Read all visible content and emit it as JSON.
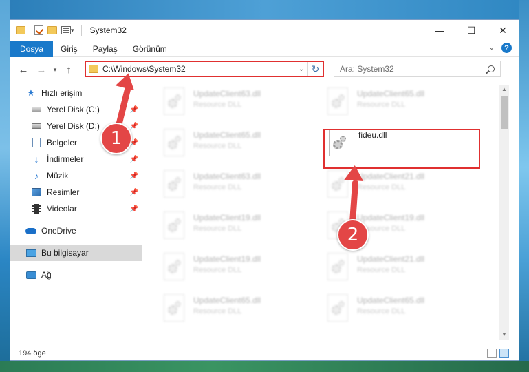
{
  "window": {
    "title": "System32",
    "controls": {
      "minimize": "—",
      "maximize": "☐",
      "close": "✕"
    }
  },
  "ribbon": {
    "tabs": [
      "Dosya",
      "Giriş",
      "Paylaş",
      "Görünüm"
    ],
    "help_icon": "?"
  },
  "address": {
    "path": "C:\\Windows\\System32",
    "search_placeholder": "Ara: System32"
  },
  "sidebar": {
    "items": [
      {
        "label": "Hızlı erişim",
        "icon": "star-icon"
      },
      {
        "label": "Yerel Disk (C:)",
        "icon": "drive-icon"
      },
      {
        "label": "Yerel Disk (D:)",
        "icon": "drive-icon"
      },
      {
        "label": "Belgeler",
        "icon": "documents-icon"
      },
      {
        "label": "İndirmeler",
        "icon": "download-icon"
      },
      {
        "label": "Müzik",
        "icon": "music-icon"
      },
      {
        "label": "Resimler",
        "icon": "pictures-icon"
      },
      {
        "label": "Videolar",
        "icon": "videos-icon"
      },
      {
        "label": "OneDrive",
        "icon": "cloud-icon"
      },
      {
        "label": "Bu bilgisayar",
        "icon": "computer-icon"
      },
      {
        "label": "Ağ",
        "icon": "network-icon"
      }
    ]
  },
  "files": [
    {
      "name": "UpdateClient63.dll",
      "desc": "Resource DLL"
    },
    {
      "name": "UpdateClient65.dll",
      "desc": "Resource DLL"
    },
    {
      "name": "UpdateClient65.dll",
      "desc": "Resource DLL"
    },
    {
      "name": "fideu.dll",
      "desc": ""
    },
    {
      "name": "UpdateClient63.dll",
      "desc": "Resource DLL"
    },
    {
      "name": "UpdateClient21.dll",
      "desc": "Resource DLL"
    },
    {
      "name": "UpdateClient19.dll",
      "desc": "Resource DLL"
    },
    {
      "name": "UpdateClient19.dll",
      "desc": "Resource DLL"
    },
    {
      "name": "UpdateClient19.dll",
      "desc": "Resource DLL"
    },
    {
      "name": "UpdateClient21.dll",
      "desc": "Resource DLL"
    },
    {
      "name": "UpdateClient65.dll",
      "desc": "Resource DLL"
    },
    {
      "name": "UpdateClient65.dll",
      "desc": "Resource DLL"
    }
  ],
  "status": {
    "count": "194 öge"
  },
  "annotations": {
    "step1": "1",
    "step2": "2"
  },
  "colors": {
    "accent": "#1979ca",
    "highlight": "#e03030",
    "annotation": "#e34646"
  }
}
